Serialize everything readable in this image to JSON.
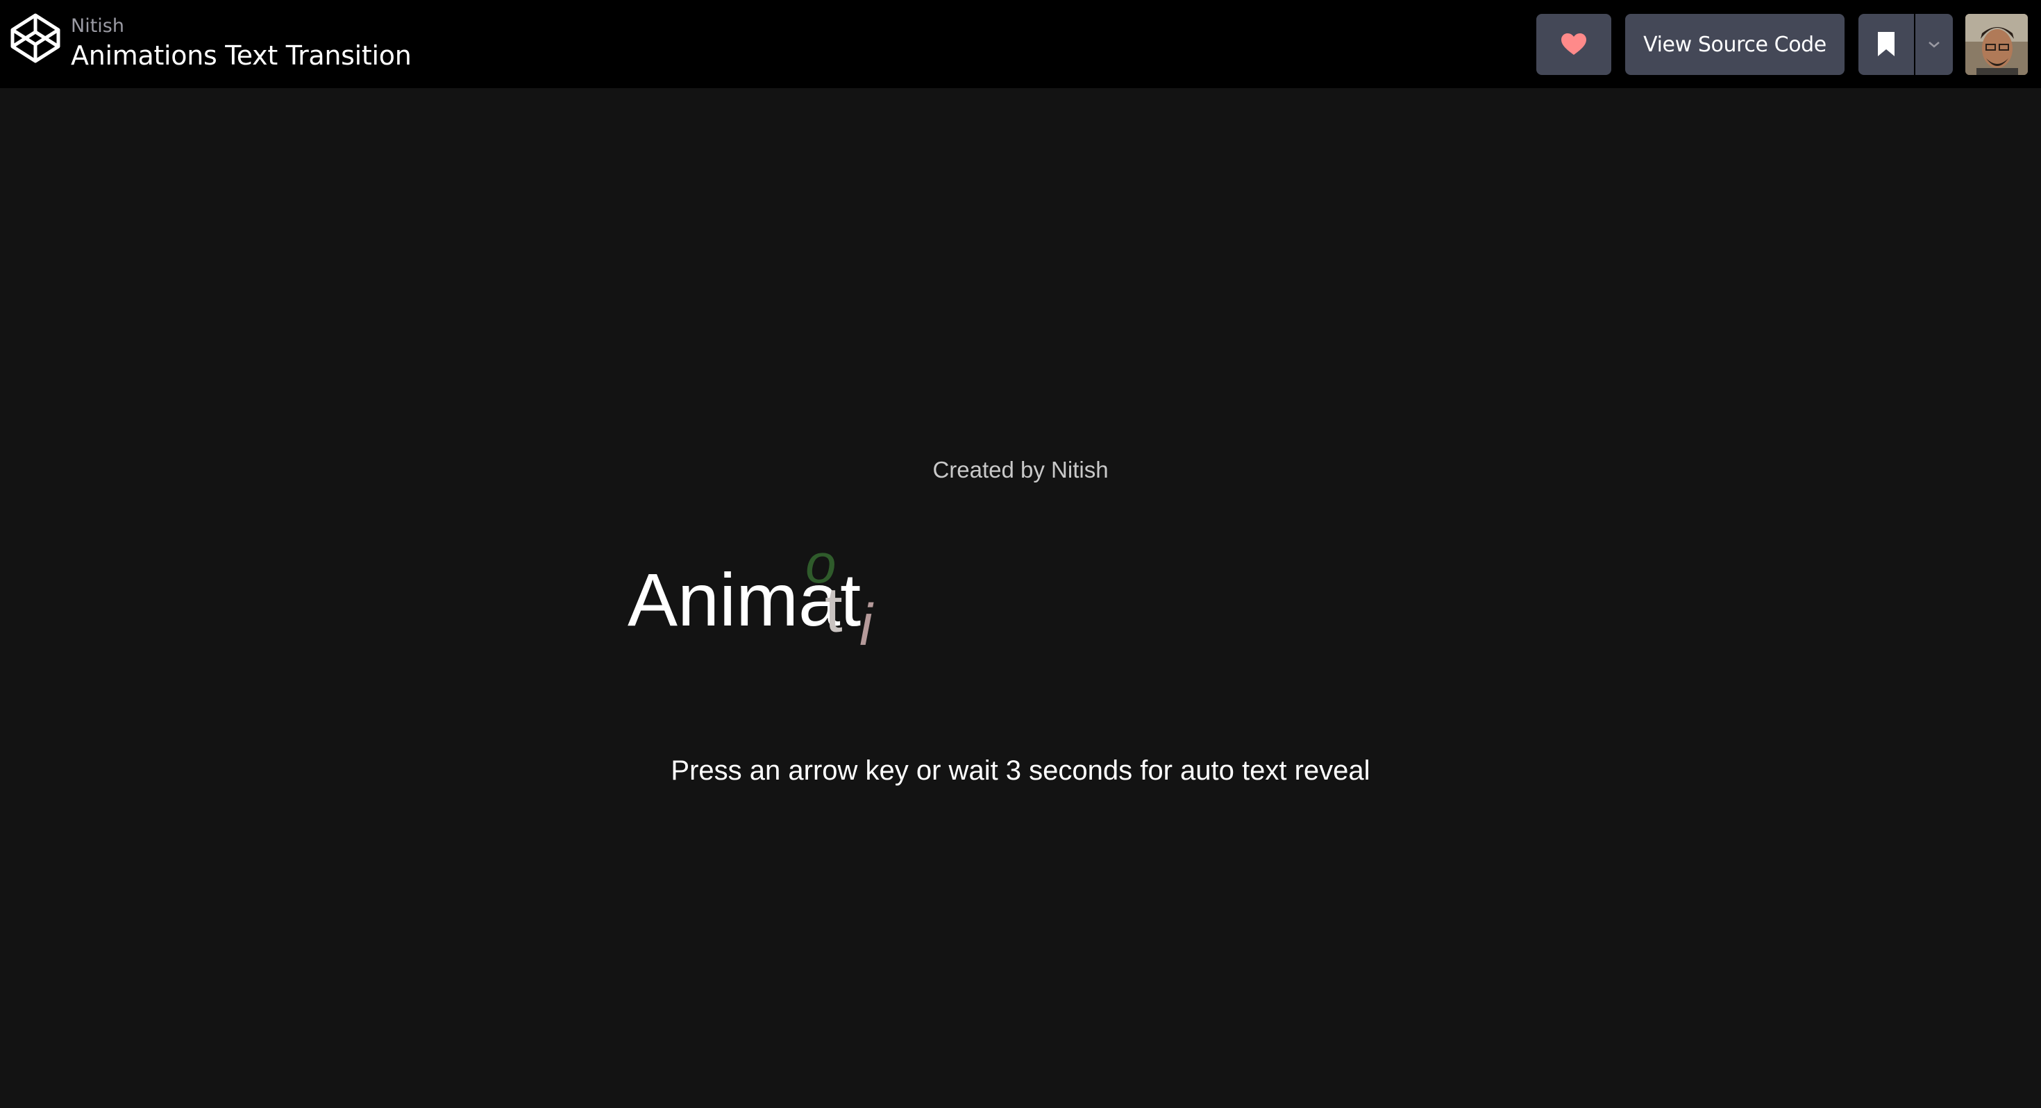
{
  "header": {
    "author": "Nitish",
    "title": "Animations Text Transition",
    "buttons": {
      "heart_icon": "heart-icon",
      "view_source_label": "View Source Code",
      "bookmark_icon": "bookmark-icon",
      "dropdown_icon": "chevron-down-icon"
    },
    "colors": {
      "background": "#000000",
      "button": "#444857",
      "heart": "#ff8a8a"
    }
  },
  "main": {
    "credit": "Created by Nitish",
    "animated_text": {
      "static": "Animat",
      "transition_letters": [
        "t",
        "o",
        "i"
      ],
      "letter_colors": [
        "#c9c3c1",
        "#2f5b2b",
        "#b59a9a"
      ]
    },
    "hint": "Press an arrow key or wait 3 seconds for auto text reveal",
    "background": "#131313"
  }
}
